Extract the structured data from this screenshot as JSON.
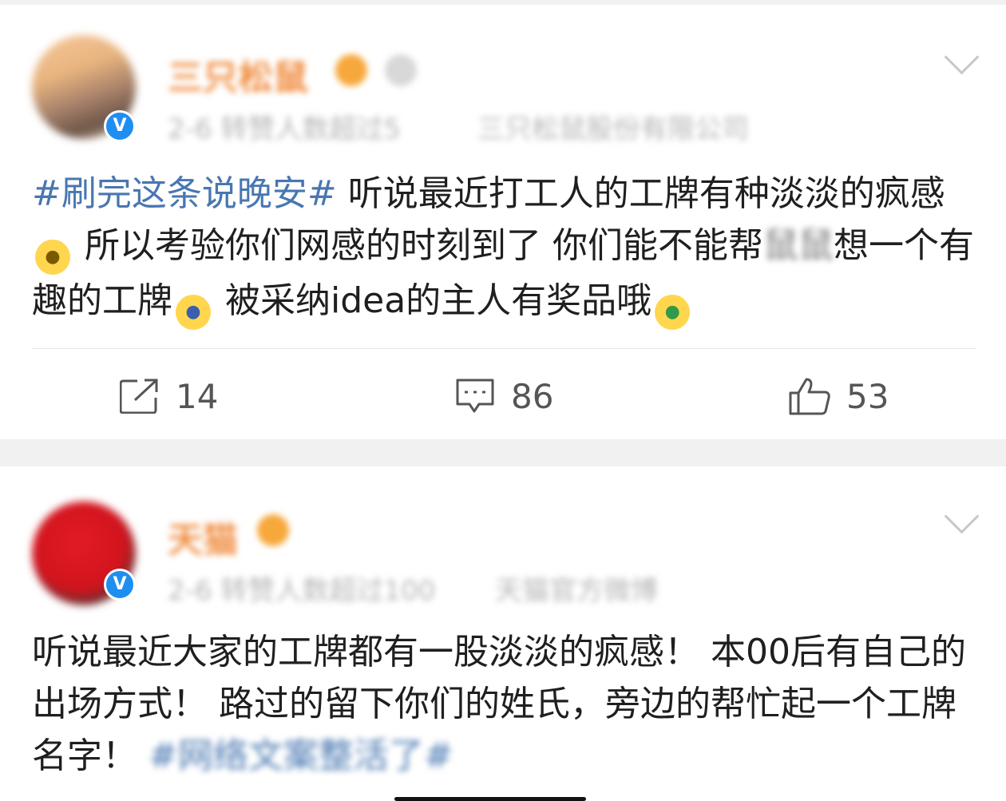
{
  "posts": [
    {
      "username": "三只松鼠",
      "meta_time_source": "2-6 转赞人数超过5",
      "meta_company": "三只松鼠股份有限公司",
      "text": {
        "hashtag": "#刷完这条说晚安#",
        "part1": "听说最近打工人的工牌有种淡淡的疯感",
        "part2": "所以考验你们网感的时刻到了 你们能不能帮",
        "blurred": "鼠鼠",
        "part3": "想一个有趣的工牌",
        "part4": "被采纳idea的主人有奖品哦"
      },
      "actions": {
        "share_count": "14",
        "comment_count": "86",
        "like_count": "53"
      }
    },
    {
      "username": "天猫",
      "meta_time_source": "2-6 转赞人数超过100",
      "meta_company": "天猫官方微博",
      "text": {
        "part1": "听说最近大家的工牌都有一股淡淡的疯感！ 本00后有自己的出场方式！ 路过的留下你们的姓氏，旁边的帮忙起一个工牌名字！",
        "blurred_tag": "#网络文案整活了#"
      }
    }
  ],
  "icons": {
    "verified": "verified-v-icon",
    "more": "chevron-down-icon",
    "share": "share-icon",
    "comment": "comment-icon",
    "like": "thumbs-up-icon",
    "v_glyph": "V"
  },
  "colors": {
    "hashtag": "#4877b1",
    "verified": "#1f8ef1",
    "username": "#f08a3c"
  }
}
